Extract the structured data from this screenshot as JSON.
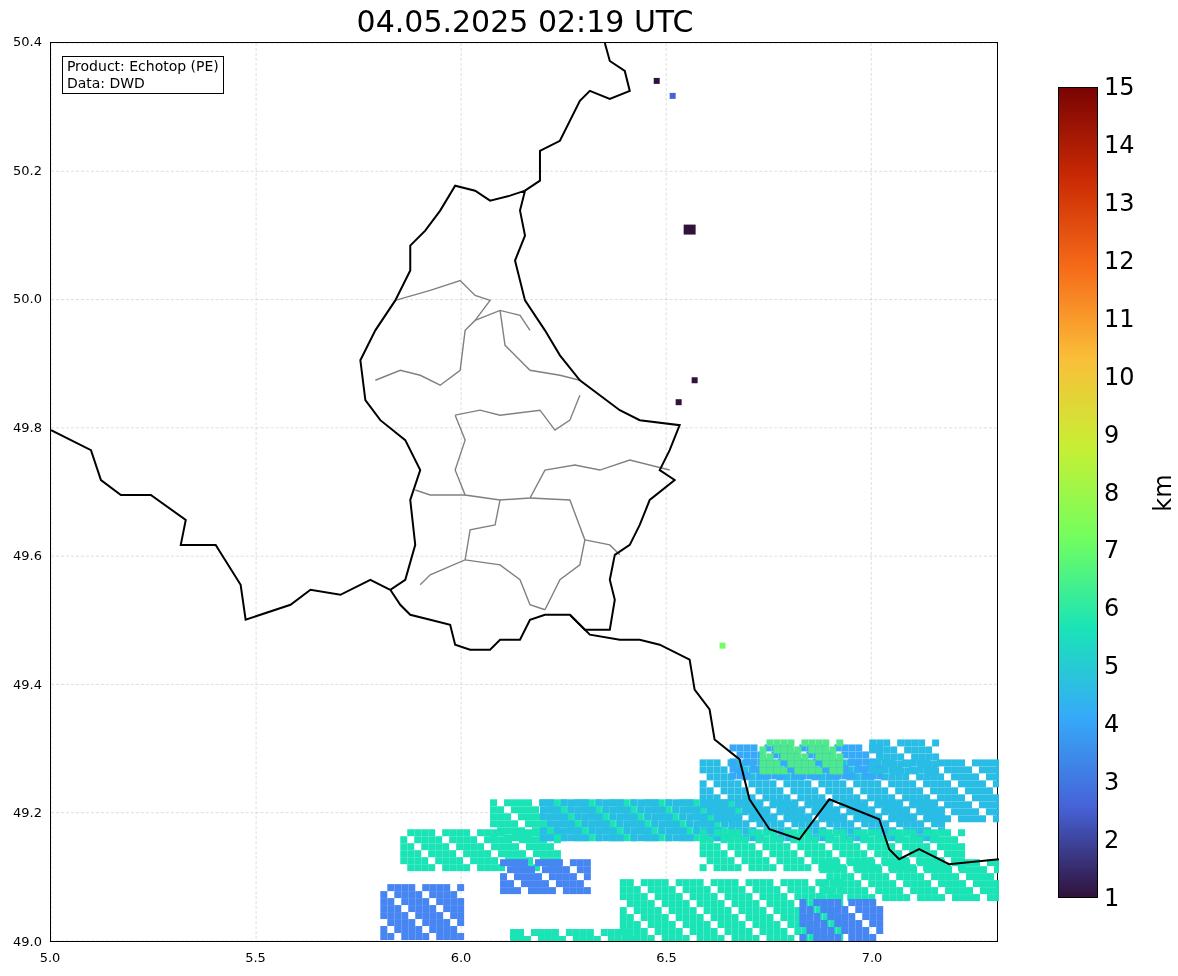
{
  "figure": {
    "title": "04.05.2025 02:19 UTC",
    "info_box": [
      "Product: Echotop (PE)",
      "Data: DWD"
    ],
    "x_ticks": [
      "5.0",
      "5.5",
      "6.0",
      "6.5",
      "7.0"
    ],
    "y_ticks": [
      "50.4",
      "50.2",
      "50.0",
      "49.8",
      "49.6",
      "49.4",
      "49.2",
      "49.0"
    ],
    "colorbar": {
      "label": "km",
      "ticks": [
        "15",
        "14",
        "13",
        "12",
        "11",
        "10",
        "9",
        "8",
        "7",
        "6",
        "5",
        "4",
        "3",
        "2",
        "1"
      ]
    }
  }
}
